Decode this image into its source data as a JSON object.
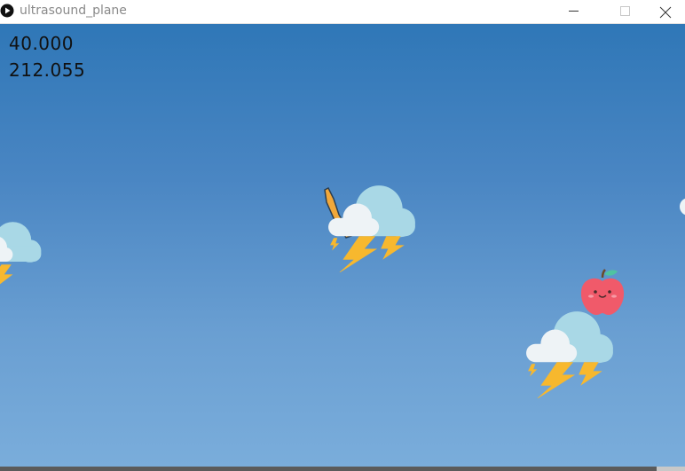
{
  "window": {
    "title": "ultrasound_plane",
    "minimize_icon": "minimize-icon",
    "maximize_icon": "maximize-icon",
    "close_icon": "close-icon"
  },
  "hud": {
    "value_1": "40.000",
    "value_2": "212.055"
  },
  "scene": {
    "sky_top": "#2f77b7",
    "sky_bottom": "#7aaddb",
    "sprites": [
      "storm-cloud",
      "storm-cloud",
      "storm-cloud",
      "plane",
      "apple",
      "cloud"
    ]
  }
}
